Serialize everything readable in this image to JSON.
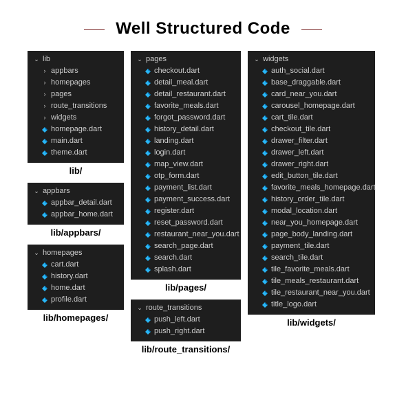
{
  "title": "Well Structured Code",
  "col1": {
    "lib": {
      "header": "lib",
      "folders": [
        "appbars",
        "homepages",
        "pages",
        "route_transitions",
        "widgets"
      ],
      "files": [
        "homepage.dart",
        "main.dart",
        "theme.dart"
      ],
      "caption": "lib/"
    },
    "appbars": {
      "header": "appbars",
      "files": [
        "appbar_detail.dart",
        "appbar_home.dart"
      ],
      "caption": "lib/appbars/"
    },
    "homepages": {
      "header": "homepages",
      "files": [
        "cart.dart",
        "history.dart",
        "home.dart",
        "profile.dart"
      ],
      "caption": "lib/homepages/"
    }
  },
  "col2": {
    "pages": {
      "header": "pages",
      "files": [
        "checkout.dart",
        "detail_meal.dart",
        "detail_restaurant.dart",
        "favorite_meals.dart",
        "forgot_password.dart",
        "history_detail.dart",
        "landing.dart",
        "login.dart",
        "map_view.dart",
        "otp_form.dart",
        "payment_list.dart",
        "payment_success.dart",
        "register.dart",
        "reset_password.dart",
        "restaurant_near_you.dart",
        "search_page.dart",
        "search.dart",
        "splash.dart"
      ],
      "caption": "lib/pages/"
    },
    "route": {
      "header": "route_transitions",
      "files": [
        "push_left.dart",
        "push_right.dart"
      ],
      "caption": "lib/route_transitions/"
    }
  },
  "col3": {
    "widgets": {
      "header": "widgets",
      "files": [
        "auth_social.dart",
        "base_draggable.dart",
        "card_near_you.dart",
        "carousel_homepage.dart",
        "cart_tile.dart",
        "checkout_tile.dart",
        "drawer_filter.dart",
        "drawer_left.dart",
        "drawer_right.dart",
        "edit_button_tile.dart",
        "favorite_meals_homepage.dart",
        "history_order_tile.dart",
        "modal_location.dart",
        "near_you_homepage.dart",
        "page_body_landing.dart",
        "payment_tile.dart",
        "search_tile.dart",
        "tile_favorite_meals.dart",
        "tile_meals_restaurant.dart",
        "tile_restaurant_near_you.dart",
        "title_logo.dart"
      ],
      "caption": "lib/widgets/"
    }
  }
}
